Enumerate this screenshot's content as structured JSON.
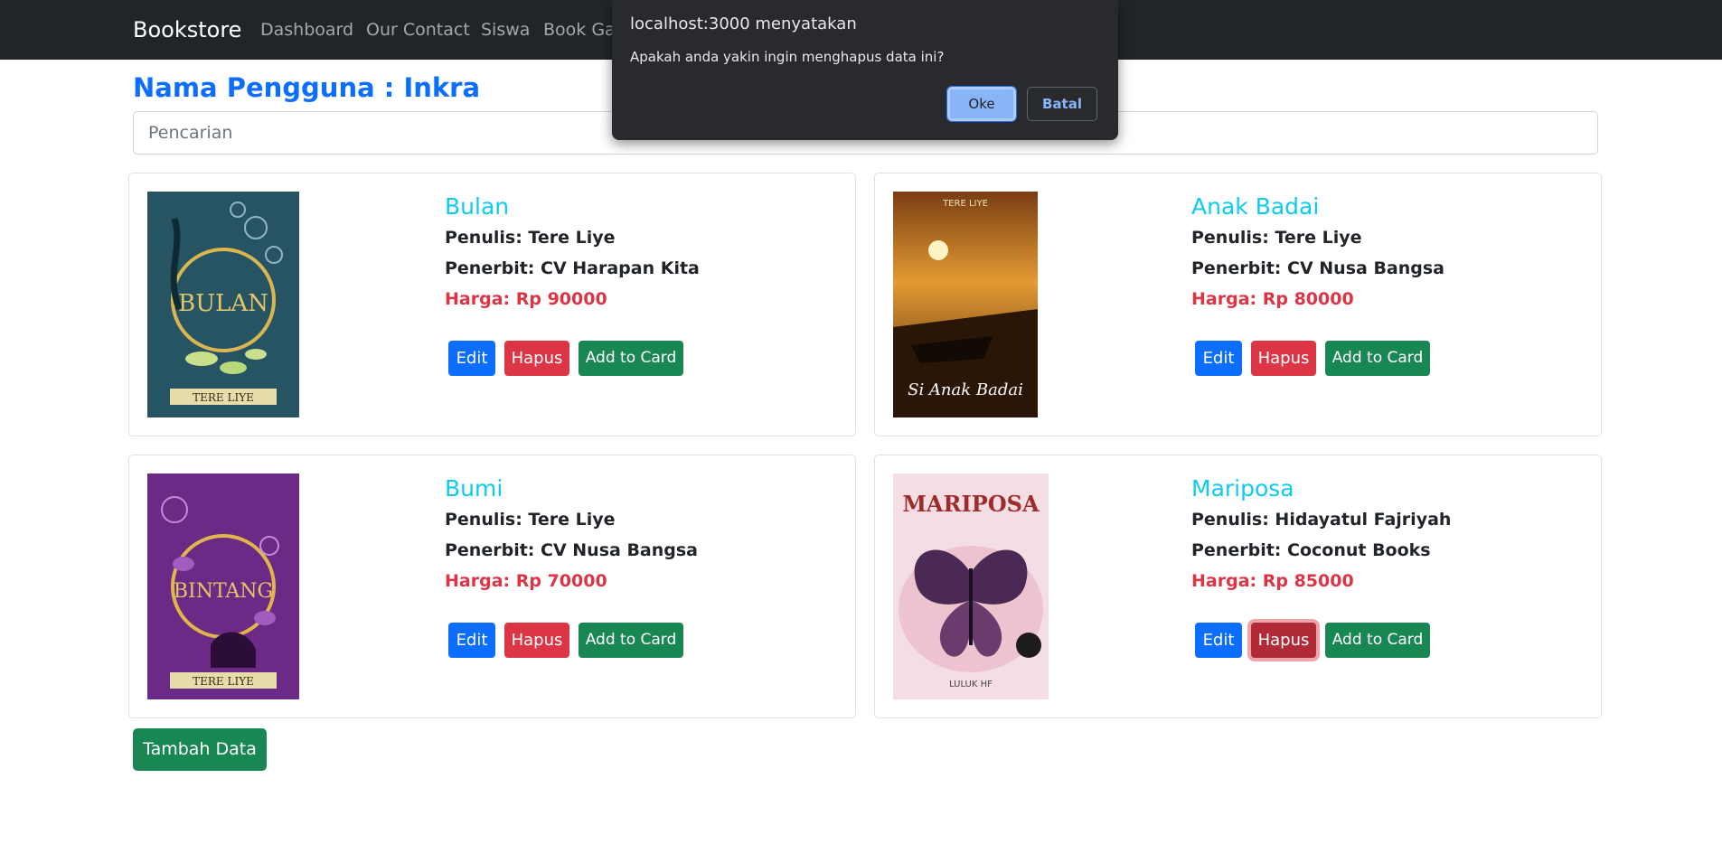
{
  "navbar": {
    "brand": "Bookstore",
    "links": [
      "Dashboard",
      "Our Contact",
      "Siswa",
      "Book Ga"
    ]
  },
  "user": {
    "title": "Nama Pengguna : Inkra"
  },
  "search": {
    "placeholder": "Pencarian"
  },
  "books": [
    {
      "title": "Bulan",
      "penulis": "Penulis: Tere Liye",
      "penerbit": "Penerbit: CV Harapan Kita",
      "harga": "Harga: Rp 90000",
      "cover_text": "BULAN",
      "cover_author": "TERE LIYE"
    },
    {
      "title": "Anak Badai",
      "penulis": "Penulis: Tere Liye",
      "penerbit": "Penerbit: CV Nusa Bangsa",
      "harga": "Harga: Rp 80000",
      "cover_text": "Si Anak Badai",
      "cover_author": "TERE LIYE"
    },
    {
      "title": "Bumi",
      "penulis": "Penulis: Tere Liye",
      "penerbit": "Penerbit: CV Nusa Bangsa",
      "harga": "Harga: Rp 70000",
      "cover_text": "BINTANG",
      "cover_author": "TERE LIYE"
    },
    {
      "title": "Mariposa",
      "penulis": "Penulis: Hidayatul Fajriyah",
      "penerbit": "Penerbit: Coconut Books",
      "harga": "Harga: Rp 85000",
      "cover_text": "MARIPOSA",
      "cover_author": "LULUK HF"
    }
  ],
  "buttons": {
    "edit": "Edit",
    "hapus": "Hapus",
    "add": "Add to Card",
    "tambah": "Tambah Data"
  },
  "dialog": {
    "title": "localhost:3000 menyatakan",
    "message": "Apakah anda yakin ingin menghapus data ini?",
    "ok": "Oke",
    "cancel": "Batal"
  },
  "colors": {
    "navbar": "#212529",
    "primary": "#0d6efd",
    "danger": "#dc3545",
    "success": "#198754",
    "info": "#0dcaf0"
  }
}
